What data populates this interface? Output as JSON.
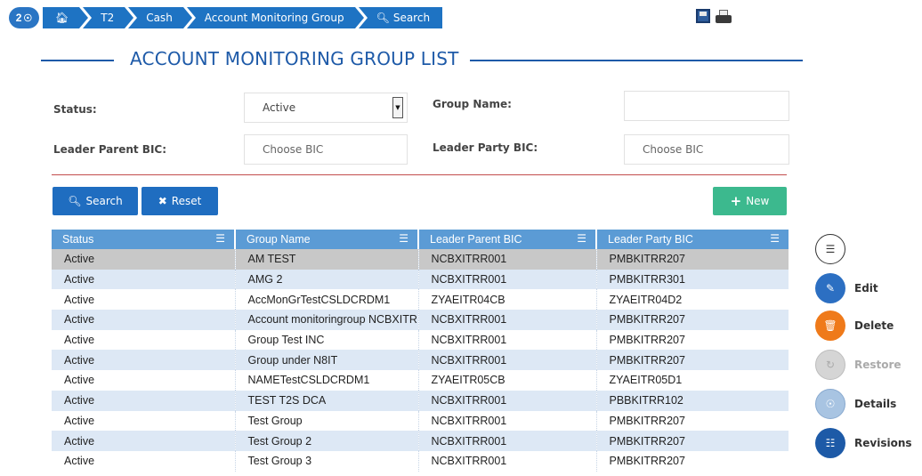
{
  "breadcrumb": {
    "count": "2",
    "items": [
      "T2",
      "Cash",
      "Account Monitoring Group",
      "Search"
    ]
  },
  "page_title": "ACCOUNT MONITORING GROUP LIST",
  "filters": {
    "status_label": "Status:",
    "status_value": "Active",
    "group_name_label": "Group Name:",
    "group_name_value": "",
    "leader_parent_bic_label": "Leader Parent BIC:",
    "leader_parent_bic_placeholder": "Choose BIC",
    "leader_party_bic_label": "Leader Party BIC:",
    "leader_party_bic_placeholder": "Choose BIC"
  },
  "buttons": {
    "search": "Search",
    "reset": "Reset",
    "new": "New"
  },
  "table": {
    "columns": [
      "Status",
      "Group Name",
      "Leader Parent BIC",
      "Leader Party BIC"
    ],
    "rows": [
      [
        "Active",
        "AM TEST",
        "NCBXITRR001",
        "PMBKITRR207"
      ],
      [
        "Active",
        "AMG 2",
        "NCBXITRR001",
        "PMBKITRR301"
      ],
      [
        "Active",
        "AccMonGrTestCSLDCRDM1",
        "ZYAEITR04CB",
        "ZYAEITR04D2"
      ],
      [
        "Active",
        "Account monitoringroup NCBXITR",
        "NCBXITRR001",
        "PMBKITRR207"
      ],
      [
        "Active",
        "Group Test INC",
        "NCBXITRR001",
        "PMBKITRR207"
      ],
      [
        "Active",
        "Group under N8IT",
        "NCBXITRR001",
        "PMBKITRR207"
      ],
      [
        "Active",
        "NAMETestCSLDCRDM1",
        "ZYAEITR05CB",
        "ZYAEITR05D1"
      ],
      [
        "Active",
        "TEST T2S DCA",
        "NCBXITRR001",
        "PBBKITRR102"
      ],
      [
        "Active",
        "Test Group",
        "NCBXITRR001",
        "PMBKITRR207"
      ],
      [
        "Active",
        "Test Group 2",
        "NCBXITRR001",
        "PMBKITRR207"
      ],
      [
        "Active",
        "Test Group 3",
        "NCBXITRR001",
        "PMBKITRR207"
      ]
    ]
  },
  "actions": {
    "edit": "Edit",
    "delete": "Delete",
    "restore": "Restore",
    "details": "Details",
    "revisions": "Revisions"
  }
}
